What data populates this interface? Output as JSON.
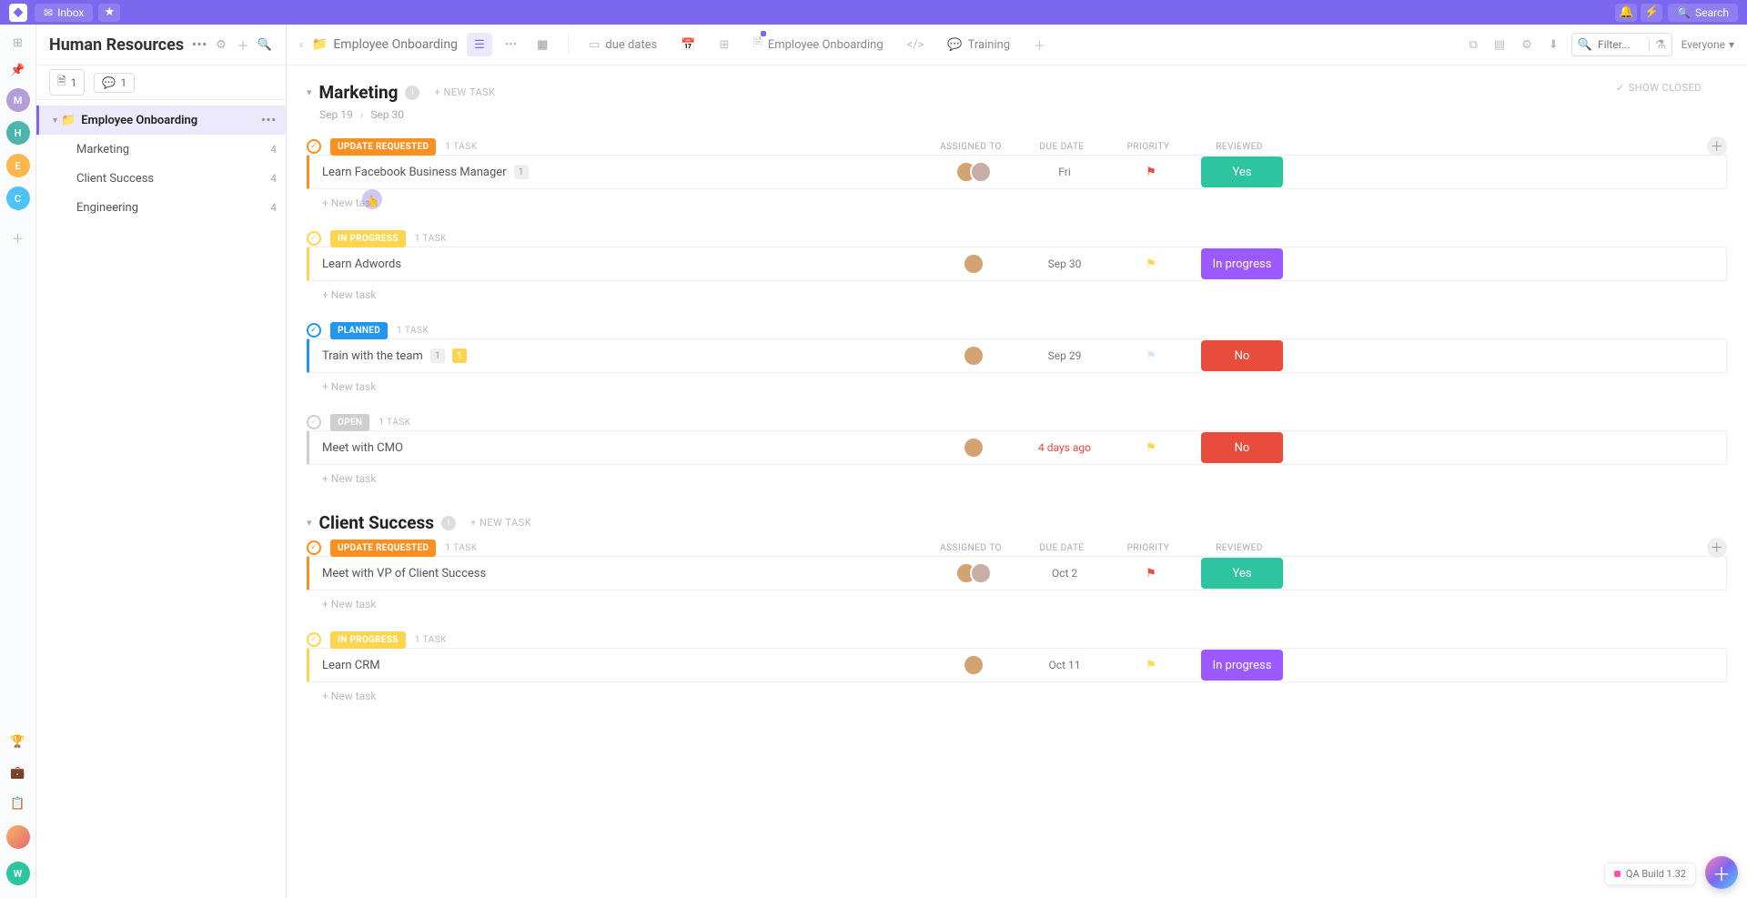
{
  "topbar": {
    "inbox": "Inbox",
    "search": "Search"
  },
  "rail": {
    "avatars": [
      {
        "letter": "M",
        "color": "#b39ddb"
      },
      {
        "letter": "H",
        "color": "#4db6ac"
      },
      {
        "letter": "E",
        "color": "#ffb74d"
      },
      {
        "letter": "C",
        "color": "#4fc3f7"
      }
    ],
    "user_letter": "W"
  },
  "sidebar": {
    "title": "Human Resources",
    "doc_count": "1",
    "chat_count": "1",
    "folder": {
      "label": "Employee Onboarding"
    },
    "lists": [
      {
        "label": "Marketing",
        "count": "4"
      },
      {
        "label": "Client Success",
        "count": "4"
      },
      {
        "label": "Engineering",
        "count": "4"
      }
    ]
  },
  "toolbar": {
    "breadcrumb": "Employee Onboarding",
    "tabs": [
      {
        "label": "due dates"
      },
      {
        "label": "Employee Onboarding"
      },
      {
        "label": "Training"
      }
    ],
    "filter_placeholder": "Filter...",
    "everyone": "Everyone"
  },
  "columns": {
    "assigned": "ASSIGNED TO",
    "due": "DUE DATE",
    "priority": "PRIORITY",
    "reviewed": "REVIEWED"
  },
  "labels": {
    "new_task_upper": "+ NEW TASK",
    "new_task": "+ New task",
    "show_closed": "SHOW CLOSED",
    "qa": "QA Build 1.32"
  },
  "sections": [
    {
      "name": "Marketing",
      "date_from": "Sep 19",
      "date_to": "Sep 30",
      "show_closed": true,
      "groups": [
        {
          "status": "UPDATE REQUESTED",
          "color": "#ff8f1f",
          "count": "1 TASK",
          "tasks": [
            {
              "title": "Learn Facebook Business Manager",
              "badges": [
                {
                  "text": "1",
                  "cls": ""
                }
              ],
              "avatars": 2,
              "due": "Fri",
              "overdue": false,
              "flag": "#e74c3c",
              "review": {
                "text": "Yes",
                "color": "#2ec4a0"
              }
            }
          ]
        },
        {
          "status": "IN PROGRESS",
          "color": "#ffd54f",
          "count": "1 TASK",
          "tasks": [
            {
              "title": "Learn Adwords",
              "badges": [],
              "avatars": 1,
              "due": "Sep 30",
              "overdue": false,
              "flag": "#ffd54f",
              "review": {
                "text": "In progress",
                "color": "#9b59ff"
              }
            }
          ]
        },
        {
          "status": "PLANNED",
          "color": "#2196f3",
          "count": "1 TASK",
          "tasks": [
            {
              "title": "Train with the team",
              "badges": [
                {
                  "text": "1",
                  "cls": ""
                },
                {
                  "text": "1",
                  "cls": "yellow"
                }
              ],
              "avatars": 1,
              "due": "Sep 29",
              "overdue": false,
              "flag": "#cfe8ff",
              "review": {
                "text": "No",
                "color": "#e74c3c"
              }
            }
          ]
        },
        {
          "status": "OPEN",
          "color": "#cfcfcf",
          "count": "1 TASK",
          "tasks": [
            {
              "title": "Meet with CMO",
              "badges": [],
              "avatars": 1,
              "due": "4 days ago",
              "overdue": true,
              "flag": "#ffd54f",
              "review": {
                "text": "No",
                "color": "#e74c3c"
              }
            }
          ]
        }
      ]
    },
    {
      "name": "Client Success",
      "groups": [
        {
          "status": "UPDATE REQUESTED",
          "color": "#ff8f1f",
          "count": "1 TASK",
          "tasks": [
            {
              "title": "Meet with VP of Client Success",
              "badges": [],
              "avatars": 2,
              "due": "Oct 2",
              "overdue": false,
              "flag": "#e74c3c",
              "review": {
                "text": "Yes",
                "color": "#2ec4a0"
              }
            }
          ]
        },
        {
          "status": "IN PROGRESS",
          "color": "#ffd54f",
          "count": "1 TASK",
          "tasks": [
            {
              "title": "Learn CRM",
              "badges": [],
              "avatars": 1,
              "due": "Oct 11",
              "overdue": false,
              "flag": "#ffd54f",
              "review": {
                "text": "In progress",
                "color": "#9b59ff"
              }
            }
          ]
        }
      ]
    }
  ]
}
